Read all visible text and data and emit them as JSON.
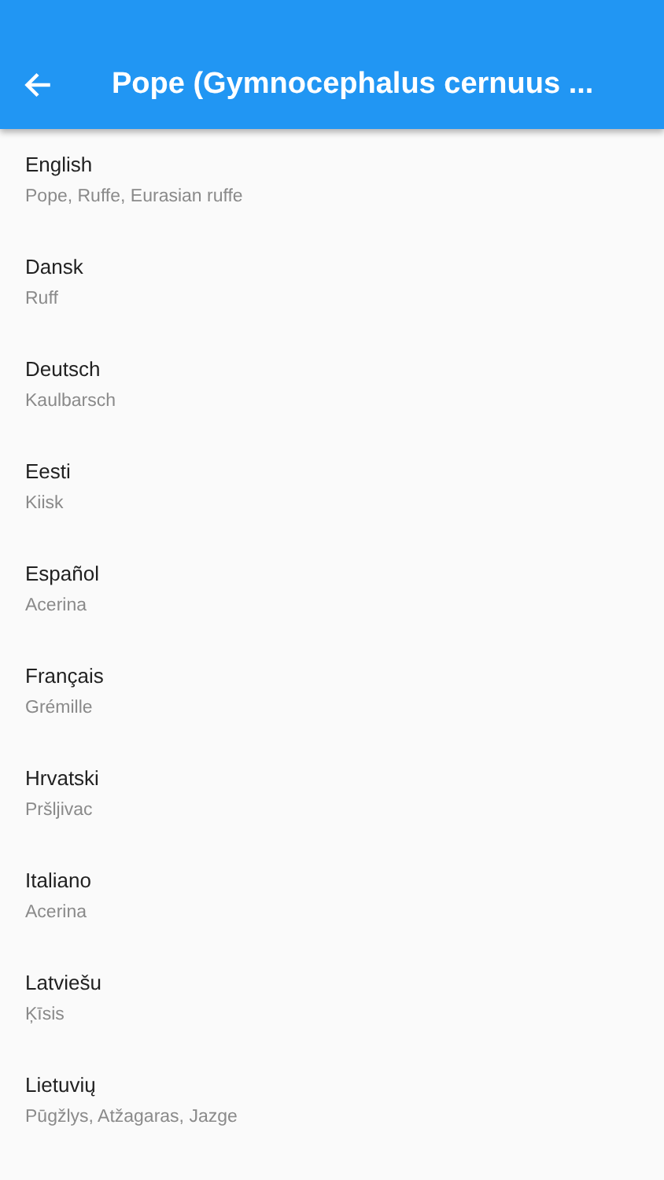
{
  "app_bar": {
    "title": "Pope (Gymnocephalus cernuus ..."
  },
  "names": [
    {
      "language": "English",
      "name": "Pope, Ruffe, Eurasian ruffe"
    },
    {
      "language": "Dansk",
      "name": "Ruff"
    },
    {
      "language": "Deutsch",
      "name": "Kaulbarsch"
    },
    {
      "language": "Eesti",
      "name": "Kiisk"
    },
    {
      "language": "Español",
      "name": "Acerina"
    },
    {
      "language": "Français",
      "name": "Grémille"
    },
    {
      "language": "Hrvatski",
      "name": "Pršljivac"
    },
    {
      "language": "Italiano",
      "name": "Acerina"
    },
    {
      "language": "Latviešu",
      "name": "Ķīsis"
    },
    {
      "language": "Lietuvių",
      "name": "Pūgžlys, Atžagaras, Jazge"
    }
  ]
}
